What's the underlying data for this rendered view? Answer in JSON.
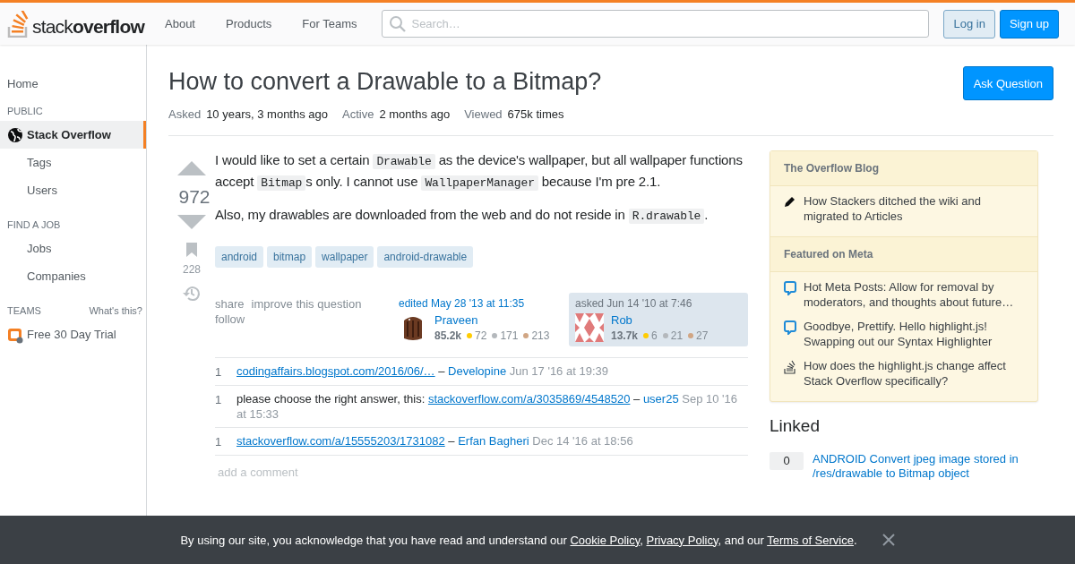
{
  "header": {
    "logo": {
      "light": "stack",
      "bold": "overflow"
    },
    "nav": [
      {
        "label": "About"
      },
      {
        "label": "Products"
      },
      {
        "label": "For Teams"
      }
    ],
    "search": {
      "placeholder": "Search…"
    },
    "login": "Log in",
    "signup": "Sign up"
  },
  "sidebar": {
    "home": {
      "label": "Home",
      "selected": false
    },
    "sections": [
      {
        "heading": "PUBLIC",
        "items": [
          {
            "kind": "globe",
            "label": "Stack Overflow",
            "selected": true
          },
          {
            "kind": "plain",
            "label": "Tags",
            "selected": false
          },
          {
            "kind": "plain",
            "label": "Users",
            "selected": false
          }
        ]
      },
      {
        "heading": "FIND A JOB",
        "items": [
          {
            "kind": "plain",
            "label": "Jobs",
            "selected": false
          },
          {
            "kind": "plain",
            "label": "Companies",
            "selected": false
          }
        ]
      },
      {
        "heading": "TEAMS",
        "aside": "What's this?",
        "items": [
          {
            "kind": "teams",
            "label": "Free 30 Day Trial",
            "selected": false
          }
        ]
      }
    ]
  },
  "question": {
    "title": "How to convert a Drawable to a Bitmap?",
    "ask_button": "Ask Question",
    "meta": [
      {
        "label": "Asked",
        "value": "10 years, 3 months ago"
      },
      {
        "label": "Active",
        "value": "2 months ago"
      },
      {
        "label": "Viewed",
        "value": "675k times"
      }
    ],
    "votes": "972",
    "bookmarks": "228",
    "body": [
      [
        {
          "kind": "text",
          "text": "I would like to set a certain "
        },
        {
          "kind": "code",
          "text": "Drawable"
        },
        {
          "kind": "text",
          "text": " as the device's wallpaper, but all wallpaper functions accept "
        },
        {
          "kind": "code",
          "text": "Bitmap"
        },
        {
          "kind": "text",
          "text": "s only. I cannot use "
        },
        {
          "kind": "code",
          "text": "WallpaperManager"
        },
        {
          "kind": "text",
          "text": " because I'm pre 2.1."
        }
      ],
      [
        {
          "kind": "text",
          "text": "Also, my drawables are downloaded from the web and do not reside in "
        },
        {
          "kind": "code",
          "text": "R.drawable"
        },
        {
          "kind": "text",
          "text": "."
        }
      ]
    ],
    "tags": [
      "android",
      "bitmap",
      "wallpaper",
      "android-drawable"
    ],
    "actions": [
      "share",
      "improve this question",
      "follow"
    ],
    "signatures": [
      {
        "kind": "editor",
        "action": "edited May 28 '13 at 11:35",
        "user": "Praveen",
        "rep": "85.2k",
        "badges": [
          {
            "color": "#ffcc01",
            "count": "72"
          },
          {
            "color": "#b4b8bc",
            "count": "171"
          },
          {
            "color": "#d1a684",
            "count": "213"
          }
        ]
      },
      {
        "kind": "owner",
        "action": "asked Jun 14 '10 at 7:46",
        "user": "Rob",
        "rep": "13.7k",
        "badges": [
          {
            "color": "#ffcc01",
            "count": "6"
          },
          {
            "color": "#b4b8bc",
            "count": "21"
          },
          {
            "color": "#d1a684",
            "count": "27"
          }
        ]
      }
    ],
    "comments": [
      {
        "score": "1",
        "link": "codingaffairs.blogspot.com/2016/06/…",
        "separator": "–",
        "user": "Developine",
        "date": "Jun 17 '16 at 19:39"
      },
      {
        "score": "1",
        "text": "please choose the right answer, this: ",
        "link": "stackoverflow.com/a/3035869/4548520",
        "separator": "–",
        "user": "user25",
        "date": "Sep 10 '16 at 15:33"
      },
      {
        "score": "1",
        "link": "stackoverflow.com/a/15555203/1731082",
        "separator": "–",
        "user": "Erfan Bagheri",
        "date": "Dec 14 '16 at 18:56"
      }
    ],
    "add_comment": "add a comment"
  },
  "side": {
    "blog": [
      {
        "heading": "The Overflow Blog",
        "items": [
          {
            "kind": "pencil",
            "text": "How Stackers ditched the wiki and migrated to Articles"
          }
        ]
      },
      {
        "heading": "Featured on Meta",
        "items": [
          {
            "kind": "chat",
            "text": "Hot Meta Posts: Allow for removal by moderators, and thoughts about future…"
          },
          {
            "kind": "chat",
            "text": "Goodbye, Prettify. Hello highlight.js! Swapping out our Syntax Highlighter"
          },
          {
            "kind": "stack",
            "text": "How does the highlight.js change affect Stack Overflow specifically?"
          }
        ]
      }
    ],
    "linked": {
      "heading": "Linked",
      "items": [
        {
          "count": "0",
          "title": "ANDROID Convert jpeg image stored in /res/drawable to Bitmap object"
        }
      ]
    }
  },
  "cookie_banner": {
    "parts": [
      {
        "kind": "text",
        "text": "By using our site, you acknowledge that you have read and understand our "
      },
      {
        "kind": "link",
        "text": "Cookie Policy"
      },
      {
        "kind": "text",
        "text": ", "
      },
      {
        "kind": "link",
        "text": "Privacy Policy"
      },
      {
        "kind": "text",
        "text": ", and our "
      },
      {
        "kind": "link",
        "text": "Terms of Service"
      },
      {
        "kind": "text",
        "text": "."
      }
    ]
  }
}
